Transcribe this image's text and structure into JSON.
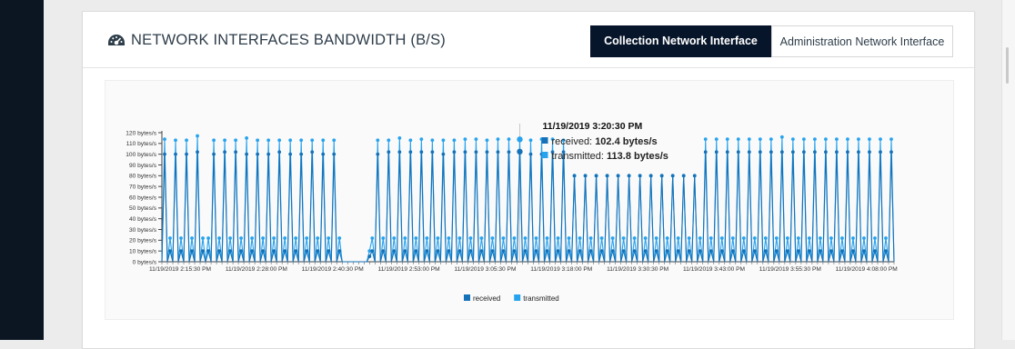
{
  "panel": {
    "title": "NETWORK INTERFACES BANDWIDTH (B/S)",
    "title_icon": "dashboard-gauge-icon",
    "tabs": [
      {
        "label": "Collection Network Interface",
        "active": true
      },
      {
        "label": "Administration Network Interface",
        "active": false
      }
    ]
  },
  "colors": {
    "received": "#1572b8",
    "transmitted": "#27a3ee",
    "active_tab_bg": "#07152a",
    "sidebar": "#0b1622"
  },
  "chart_data": {
    "type": "line",
    "ylabel": "",
    "xlabel": "",
    "ylim": [
      0,
      120
    ],
    "y_ticks": [
      {
        "value": 0,
        "label": "0 bytes/s"
      },
      {
        "value": 10,
        "label": "10 bytes/s"
      },
      {
        "value": 20,
        "label": "20 bytes/s"
      },
      {
        "value": 30,
        "label": "30 bytes/s"
      },
      {
        "value": 40,
        "label": "40 bytes/s"
      },
      {
        "value": 50,
        "label": "50 bytes/s"
      },
      {
        "value": 60,
        "label": "60 bytes/s"
      },
      {
        "value": 70,
        "label": "70 bytes/s"
      },
      {
        "value": 80,
        "label": "80 bytes/s"
      },
      {
        "value": 90,
        "label": "90 bytes/s"
      },
      {
        "value": 100,
        "label": "100 bytes/s"
      },
      {
        "value": 110,
        "label": "110 bytes/s"
      },
      {
        "value": 120,
        "label": "120 bytes/s"
      }
    ],
    "x_start": "11/19/2019 2:15:30 PM",
    "x_step_seconds": 30,
    "x_tick_labels": [
      "11/19/2019 2:15:30 PM",
      "11/19/2019 2:28:00 PM",
      "11/19/2019 2:40:30 PM",
      "11/19/2019 2:53:00 PM",
      "11/19/2019 3:05:30 PM",
      "11/19/2019 3:18:00 PM",
      "11/19/2019 3:30:30 PM",
      "11/19/2019 3:43:00 PM",
      "11/19/2019 3:55:30 PM",
      "11/19/2019 4:08:00 PM"
    ],
    "legend": {
      "placement": "bottom-center",
      "entries": [
        "received",
        "transmitted"
      ]
    },
    "series": [
      {
        "name": "received",
        "values": [
          0,
          100,
          0,
          10,
          0,
          100,
          0,
          10,
          0,
          100,
          0,
          10,
          0,
          102,
          0,
          10,
          0,
          10,
          0,
          100,
          0,
          10,
          0,
          102,
          0,
          10,
          0,
          102,
          0,
          10,
          0,
          100,
          0,
          10,
          0,
          100,
          0,
          10,
          0,
          100,
          0,
          10,
          0,
          102,
          0,
          10,
          0,
          100,
          0,
          10,
          0,
          100,
          0,
          10,
          0,
          102,
          0,
          10,
          0,
          100,
          0,
          10,
          0,
          100,
          0,
          10,
          0,
          0,
          0,
          0,
          0,
          0,
          0,
          0,
          0,
          0,
          5,
          10,
          0,
          100,
          0,
          10,
          0,
          102,
          0,
          10,
          0,
          102,
          0,
          10,
          0,
          102,
          0,
          10,
          0,
          102,
          0,
          10,
          0,
          102,
          0,
          10,
          0,
          100,
          0,
          10,
          0,
          102,
          0,
          10,
          0,
          102,
          0,
          10,
          0,
          102,
          0,
          10,
          0,
          102,
          0,
          10,
          0,
          102,
          0,
          10,
          0,
          102,
          0,
          10,
          0,
          102.4,
          0,
          10,
          0,
          100,
          0,
          10,
          0,
          100,
          0,
          10,
          0,
          102,
          0,
          10,
          0,
          102,
          0,
          10,
          0,
          80,
          0,
          10,
          0,
          80,
          0,
          10,
          0,
          80,
          0,
          10,
          0,
          80,
          0,
          10,
          0,
          80,
          0,
          10,
          0,
          80,
          0,
          10,
          0,
          80,
          0,
          10,
          0,
          80,
          0,
          10,
          0,
          80,
          0,
          10,
          0,
          80,
          0,
          10,
          0,
          80,
          0,
          10,
          0,
          80,
          0,
          10,
          0,
          102,
          0,
          10,
          0,
          102,
          0,
          10,
          0,
          102,
          0,
          10,
          0,
          102,
          0,
          10,
          0,
          102,
          0,
          10,
          0,
          102,
          0,
          10,
          0,
          102,
          0,
          10,
          0,
          102,
          0,
          10,
          0,
          102,
          0,
          10,
          0,
          102,
          0,
          10,
          0,
          102,
          0,
          10,
          0,
          102,
          0,
          10,
          0,
          102,
          0,
          10,
          0,
          102,
          0,
          10,
          0,
          102,
          0,
          10,
          0,
          102,
          0,
          10,
          0,
          102,
          0,
          10,
          0,
          102,
          0
        ]
      },
      {
        "name": "transmitted",
        "values": [
          0,
          114,
          0,
          22,
          0,
          113,
          0,
          22,
          0,
          113,
          0,
          22,
          0,
          117,
          0,
          22,
          0,
          22,
          0,
          113,
          0,
          22,
          0,
          113,
          0,
          22,
          0,
          113,
          0,
          22,
          0,
          115,
          0,
          22,
          0,
          113,
          0,
          22,
          0,
          113,
          0,
          22,
          0,
          113,
          0,
          22,
          0,
          113,
          0,
          22,
          0,
          113,
          0,
          22,
          0,
          113,
          0,
          22,
          0,
          113,
          0,
          22,
          0,
          113,
          0,
          22,
          0,
          0,
          0,
          0,
          0,
          0,
          0,
          0,
          0,
          0,
          10,
          22,
          0,
          113,
          0,
          22,
          0,
          113,
          0,
          22,
          0,
          115,
          0,
          22,
          0,
          113,
          0,
          22,
          0,
          114,
          0,
          22,
          0,
          113,
          0,
          22,
          0,
          113,
          0,
          22,
          0,
          113,
          0,
          22,
          0,
          114,
          0,
          22,
          0,
          114,
          0,
          22,
          0,
          113,
          0,
          22,
          0,
          114,
          0,
          22,
          0,
          114,
          0,
          22,
          0,
          113.8,
          0,
          22,
          0,
          113,
          0,
          22,
          0,
          114,
          0,
          22,
          0,
          114,
          0,
          22,
          0,
          113,
          0,
          22,
          0,
          80,
          0,
          22,
          0,
          80,
          0,
          22,
          0,
          80,
          0,
          22,
          0,
          80,
          0,
          22,
          0,
          80,
          0,
          22,
          0,
          80,
          0,
          22,
          0,
          80,
          0,
          22,
          0,
          80,
          0,
          22,
          0,
          80,
          0,
          22,
          0,
          80,
          0,
          22,
          0,
          80,
          0,
          22,
          0,
          80,
          0,
          22,
          0,
          114,
          0,
          22,
          0,
          114,
          0,
          22,
          0,
          114,
          0,
          22,
          0,
          114,
          0,
          22,
          0,
          114,
          0,
          22,
          0,
          114,
          0,
          22,
          0,
          114,
          0,
          22,
          0,
          116,
          0,
          22,
          0,
          114,
          0,
          22,
          0,
          114,
          0,
          22,
          0,
          114,
          0,
          22,
          0,
          114,
          0,
          22,
          0,
          114,
          0,
          22,
          0,
          114,
          0,
          22,
          0,
          114,
          0,
          22,
          0,
          114,
          0,
          22,
          0,
          114,
          0,
          22,
          0,
          114,
          0
        ]
      }
    ],
    "tooltip": {
      "title": "11/19/2019 3:20:30 PM",
      "rows": [
        {
          "series": "received",
          "label": "received: ",
          "value": "102.4 bytes/s"
        },
        {
          "series": "transmitted",
          "label": "transmitted: ",
          "value": "113.8 bytes/s"
        }
      ]
    }
  }
}
